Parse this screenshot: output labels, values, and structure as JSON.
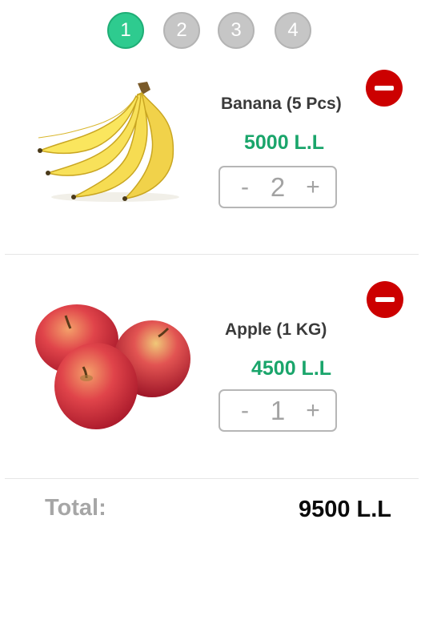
{
  "steps": [
    {
      "label": "1",
      "active": true
    },
    {
      "label": "2",
      "active": false
    },
    {
      "label": "3",
      "active": false
    },
    {
      "label": "4",
      "active": false
    }
  ],
  "cart": {
    "items": [
      {
        "name": "Banana",
        "unit": "(5 Pcs)",
        "price": "5000 L.L",
        "minus": "-",
        "quantity": "2",
        "plus": "+",
        "image": "banana-bunch"
      },
      {
        "name": "Apple",
        "unit": "(1 KG)",
        "price": "4500 L.L",
        "minus": "-",
        "quantity": "1",
        "plus": "+",
        "image": "red-apples"
      }
    ]
  },
  "total": {
    "label": "Total:",
    "value": "9500 L.L"
  },
  "colors": {
    "accent": "#2ecb8f",
    "price": "#1aa56b",
    "remove": "#cc0000",
    "step_inactive": "#c6c6c6"
  }
}
